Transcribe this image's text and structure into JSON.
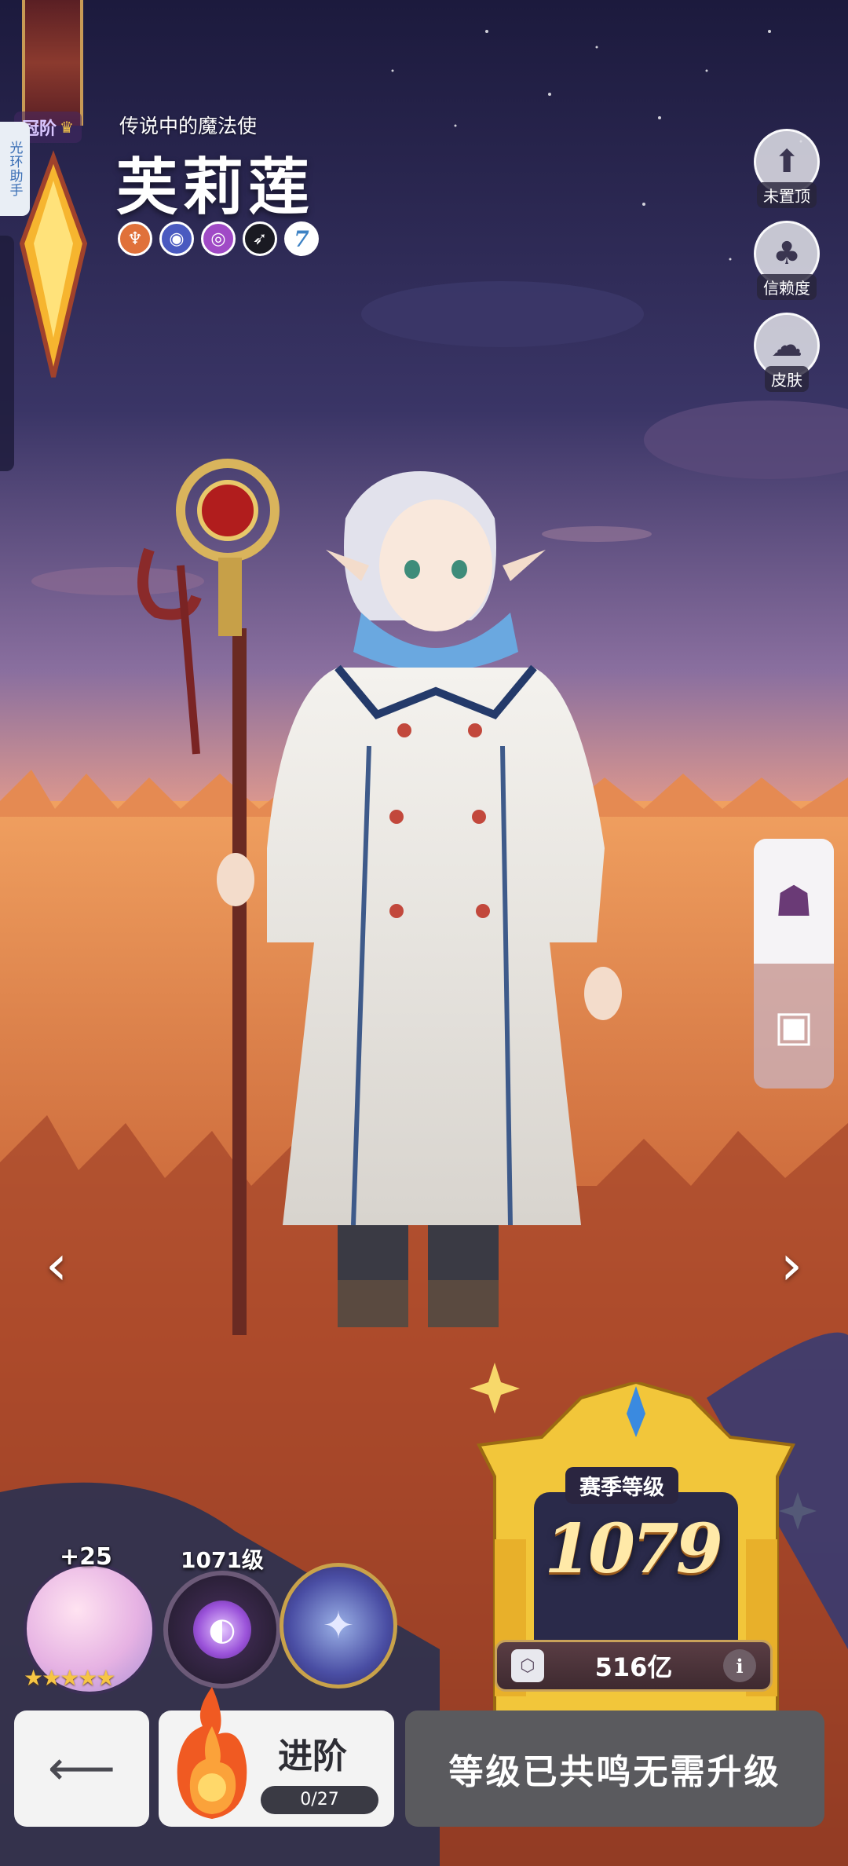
{
  "side_helper": {
    "label": "光环助手"
  },
  "character": {
    "rank_label": "冠阶",
    "title": "传说中的魔法使",
    "name": "芙莉莲",
    "level_badge": "7"
  },
  "right_buttons": [
    {
      "label": "未置顶",
      "icon": "pin-icon"
    },
    {
      "label": "信赖度",
      "icon": "clover-icon"
    },
    {
      "label": "皮肤",
      "icon": "skin-icon"
    }
  ],
  "equipment": {
    "weapon_plus": "+25",
    "weapon_stars": 5,
    "rune_level": "1071级"
  },
  "season": {
    "title": "赛季等级",
    "level": "1079",
    "currency_amount": "516亿",
    "info_label": "i"
  },
  "actions": {
    "advance_label": "进阶",
    "advance_progress": "0/27",
    "level_status": "等级已共鸣无需升级"
  },
  "colors": {
    "sky_top": "#221f47",
    "sky_bottom": "#f2a98a",
    "field": "#c5653a",
    "gold": "#f1c63a",
    "button_light": "#f3f3f3",
    "button_dark": "#5a5a5e"
  }
}
